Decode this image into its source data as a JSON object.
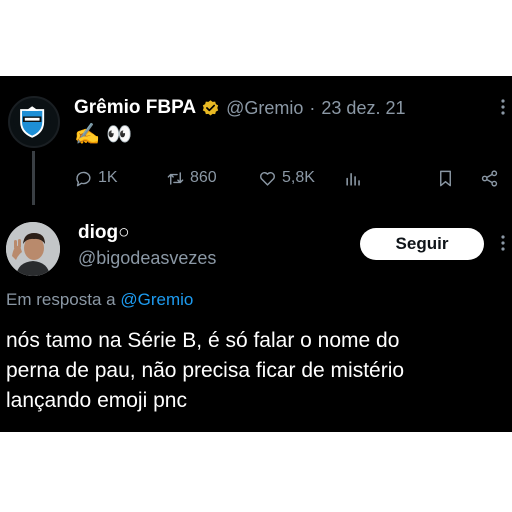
{
  "parent_tweet": {
    "author_name": "Grêmio FBPA",
    "handle": "@Gremio",
    "separator": "·",
    "date": "23 dez. 21",
    "content_emojis": [
      "✍️",
      "👀"
    ],
    "actions": {
      "replies": "1K",
      "retweets": "860",
      "likes": "5,8K"
    }
  },
  "reply_tweet": {
    "author_name": "diog",
    "name_emoji": "○",
    "handle": "@bigodeasvezes",
    "follow_label": "Seguir",
    "replying_prefix": "Em resposta a",
    "replying_handle": "@Gremio",
    "text": "nós tamo na Série B, é só falar o nome do\nperna de pau, não precisa ficar de mistério\nlançando emoji pnc"
  },
  "colors": {
    "background": "#000000",
    "primary_text": "#e7e9ea",
    "secondary_text": "#8b98a5",
    "accent": "#1d9bf0",
    "verified_gold": "#e8b923"
  }
}
